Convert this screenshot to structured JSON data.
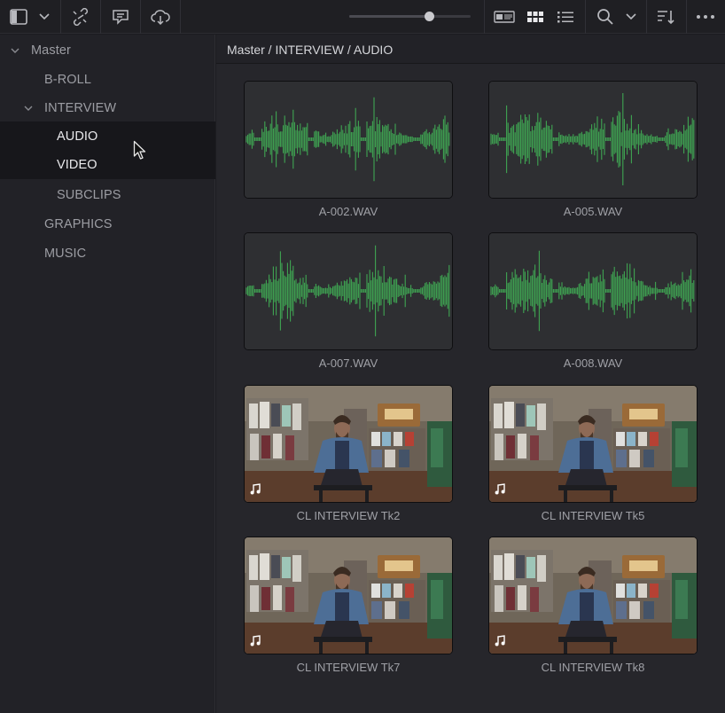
{
  "toolbar": {
    "zoom_level": 0.66,
    "icons": [
      "sidebar-toggle-icon",
      "chevron-down-icon",
      "link-icon",
      "comment-icon",
      "cloud-icon",
      "metadata-view-icon",
      "thumbnail-view-icon",
      "list-view-icon",
      "search-icon",
      "chevron-down-icon",
      "sort-icon",
      "more-icon"
    ]
  },
  "sidebar": {
    "items": [
      {
        "label": "Master",
        "expanded": true
      },
      {
        "label": "B-ROLL"
      },
      {
        "label": "INTERVIEW",
        "expanded": true
      },
      {
        "label": "AUDIO",
        "selected": true
      },
      {
        "label": "VIDEO",
        "selected": true
      },
      {
        "label": "SUBCLIPS"
      },
      {
        "label": "GRAPHICS"
      },
      {
        "label": "MUSIC"
      }
    ]
  },
  "breadcrumb": "Master / INTERVIEW / AUDIO",
  "clips": [
    {
      "name": "A-002.WAV",
      "kind": "audio"
    },
    {
      "name": "A-005.WAV",
      "kind": "audio"
    },
    {
      "name": "A-007.WAV",
      "kind": "audio"
    },
    {
      "name": "A-008.WAV",
      "kind": "audio"
    },
    {
      "name": "CL INTERVIEW Tk2",
      "kind": "video"
    },
    {
      "name": "CL INTERVIEW Tk5",
      "kind": "video"
    },
    {
      "name": "CL INTERVIEW Tk7",
      "kind": "video"
    },
    {
      "name": "CL INTERVIEW Tk8",
      "kind": "video"
    }
  ],
  "colors": {
    "waveform": "#3fa552",
    "selected_bin": "#17171b",
    "panel": "#222227"
  }
}
